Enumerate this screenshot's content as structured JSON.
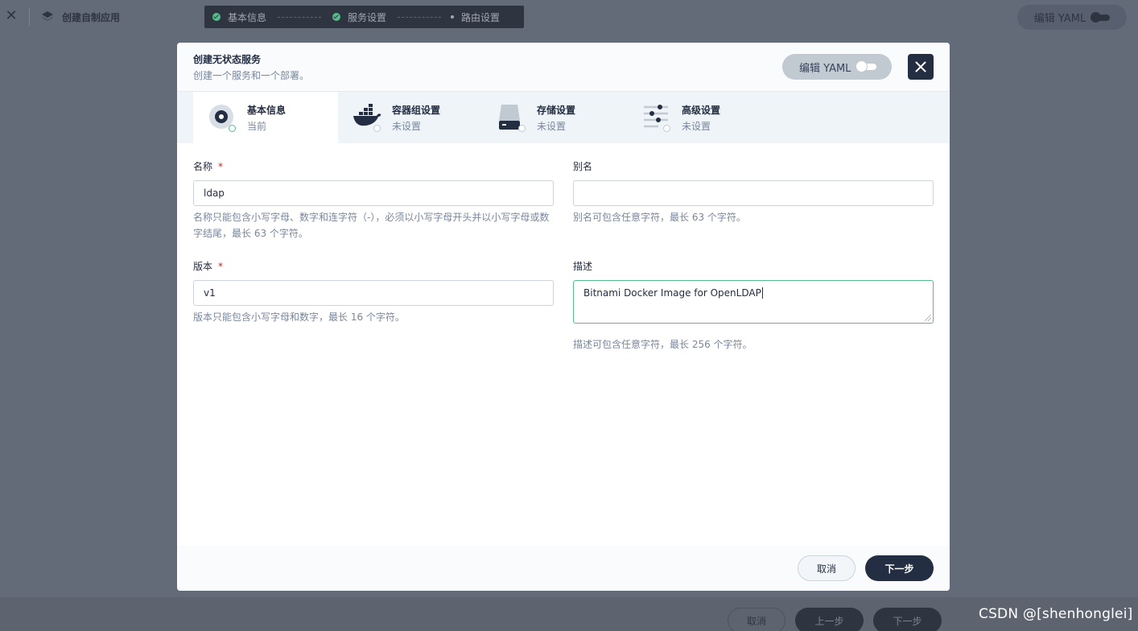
{
  "background": {
    "app_title": "创建自制应用",
    "steps": [
      {
        "label": "基本信息"
      },
      {
        "label": "服务设置"
      },
      {
        "label": "路由设置"
      }
    ],
    "yaml_label": "编辑 YAML",
    "footer": {
      "cancel": "取消",
      "prev": "上一步",
      "next": "下一步"
    }
  },
  "modal": {
    "title": "创建无状态服务",
    "subtitle": "创建一个服务和一个部署。",
    "yaml_label": "编辑 YAML",
    "tabs": [
      {
        "name": "基本信息",
        "status": "当前"
      },
      {
        "name": "容器组设置",
        "status": "未设置"
      },
      {
        "name": "存储设置",
        "status": "未设置"
      },
      {
        "name": "高级设置",
        "status": "未设置"
      }
    ],
    "form": {
      "name": {
        "label": "名称",
        "required": "*",
        "value": "ldap",
        "help": "名称只能包含小写字母、数字和连字符（-），必须以小写字母开头并以小写字母或数字结尾，最长 63 个字符。"
      },
      "alias": {
        "label": "别名",
        "value": "",
        "help": "别名可包含任意字符，最长 63 个字符。"
      },
      "version": {
        "label": "版本",
        "required": "*",
        "value": "v1",
        "help": "版本只能包含小写字母和数字，最长 16 个字符。"
      },
      "description": {
        "label": "描述",
        "value": "Bitnami Docker Image for OpenLDAP",
        "help": "描述可包含任意字符，最长 256 个字符。"
      }
    },
    "footer": {
      "cancel": "取消",
      "next": "下一步"
    }
  },
  "watermark": "CSDN @[shenhonglei]",
  "colors": {
    "primary_dark": "#242e42",
    "success_green": "#55bc8a",
    "required_red": "#ca2621",
    "overlay": "#636b78"
  }
}
